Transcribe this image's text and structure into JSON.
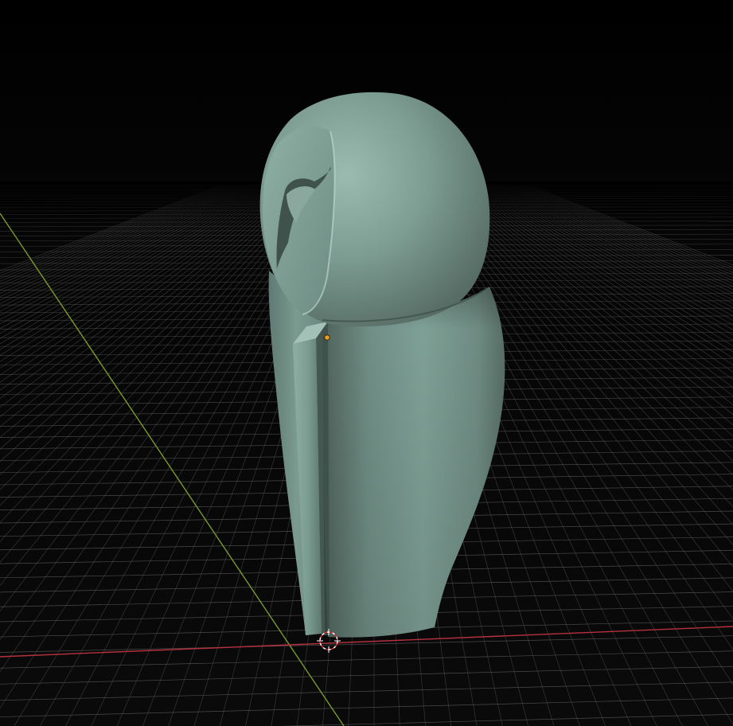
{
  "viewport": {
    "view": "3d-perspective",
    "background_color": "#050505",
    "grid_color": "#5a5a5a",
    "x_axis_color": "#b5323e",
    "y_axis_color": "#7a9a2c",
    "object": {
      "type": "sculpted-mesh",
      "shape": "stylized-owl",
      "color": "#7e9e94",
      "shading": "smooth"
    },
    "object_origin": {
      "color": "#f0a020"
    },
    "cursor_3d": {
      "colors": [
        "#ffffff",
        "#d03030"
      ]
    }
  }
}
